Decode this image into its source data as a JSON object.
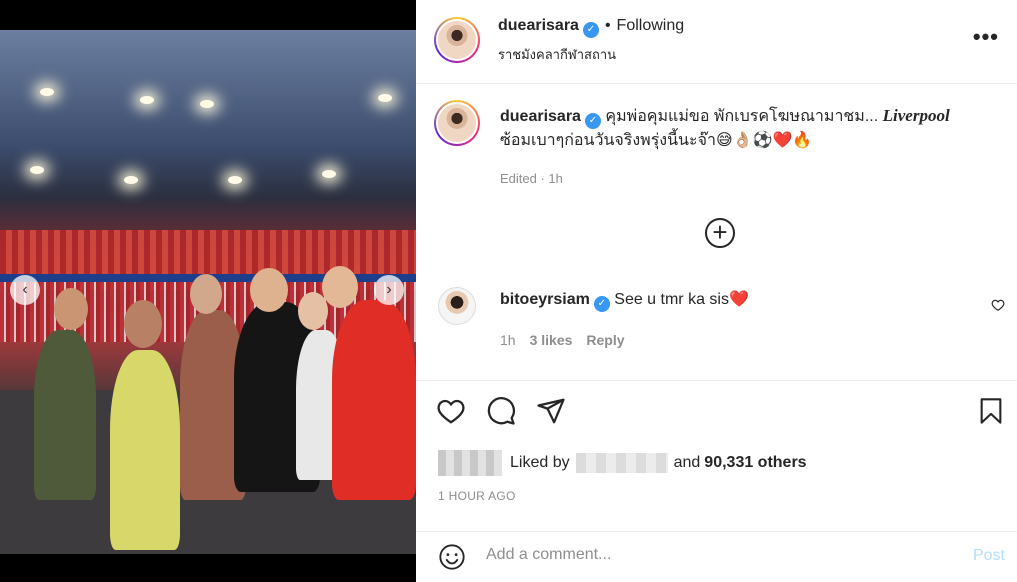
{
  "post": {
    "username": "duearisara",
    "following_label": "Following",
    "location": "ราชมังคลากีฬาสถาน",
    "more_label": "•••"
  },
  "caption": {
    "username": "duearisara",
    "text_main": "คุมพ่อคุมแม่ขอ พักเบรคโฆษณามาชม...",
    "text_emph": "Liverpool",
    "text_line2": "ซ้อมเบาๆก่อนวันจริงพรุ่งนี้นะจ๊า😅👌🏼⚽️❤️🔥",
    "edited": "Edited · 1h"
  },
  "comment": {
    "username": "bitoeyrsiam",
    "text": "See u tmr ka sis❤️",
    "time": "1h",
    "likes": "3 likes",
    "reply": "Reply"
  },
  "likes": {
    "prefix": "Liked by",
    "and": "and",
    "count": "90,331 others"
  },
  "time_ago": "1 HOUR AGO",
  "composer": {
    "placeholder": "Add a comment...",
    "post_label": "Post"
  },
  "icons": {
    "verified": "verified-badge-icon",
    "heart": "heart-icon",
    "comment": "comment-icon",
    "share": "share-icon",
    "save": "bookmark-icon",
    "emoji": "emoji-icon",
    "load_more": "plus-circle-icon"
  },
  "colors": {
    "verified_blue": "#3897f0",
    "post_disabled": "#b2dffc",
    "muted_text": "#8e8e8e"
  }
}
